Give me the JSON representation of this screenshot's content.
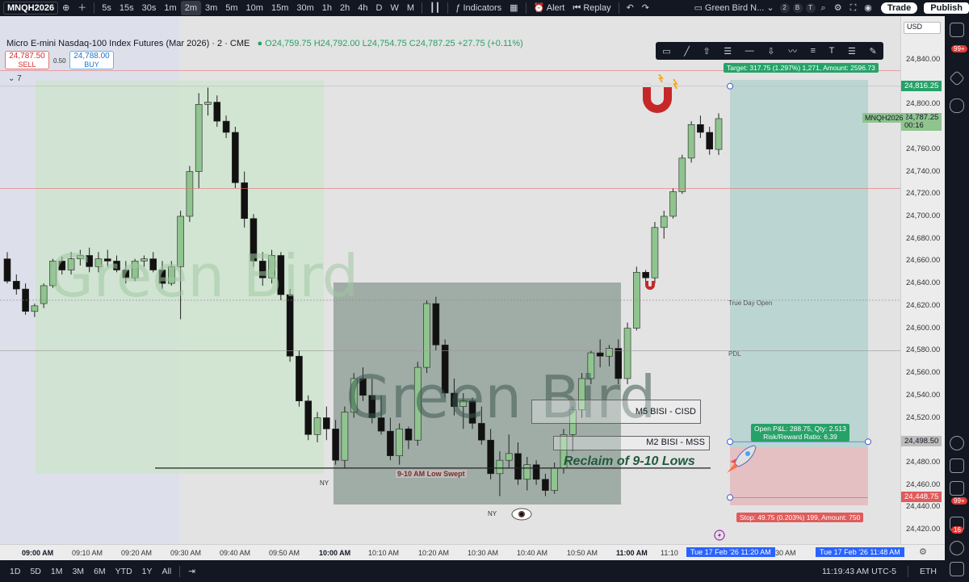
{
  "topbar": {
    "symbol": "MNQH2026",
    "intervals": [
      "5s",
      "15s",
      "30s",
      "1m",
      "2m",
      "3m",
      "5m",
      "10m",
      "15m",
      "30m",
      "1h",
      "2h",
      "4h",
      "D",
      "W",
      "M"
    ],
    "active_interval": "2m",
    "indicators_label": "Indicators",
    "alert_label": "Alert",
    "replay_label": "Replay",
    "layout_name": "Green Bird N...",
    "layout_badges": [
      "2",
      "B",
      "T"
    ],
    "trade_label": "Trade",
    "publish_label": "Publish"
  },
  "header": {
    "title": "Micro E-mini Nasdaq-100 Index Futures (Mar 2026) · 2 · CME",
    "ohlc": "O24,759.75  H24,792.00  L24,754.75  C24,787.25  +27.75 (+0.11%)",
    "sell_price": "24,787.50",
    "sell_label": "SELL",
    "spread": "0.50",
    "buy_price": "24,788.00",
    "buy_label": "BUY",
    "collapse_count": "7"
  },
  "currency": "USD",
  "drawing_tools": [
    "rectangle",
    "line",
    "arrow-up",
    "multi",
    "hline",
    "arrow-down",
    "path",
    "fib",
    "text",
    "lines",
    "brush"
  ],
  "price_axis": {
    "labels": [
      "24,840.00",
      "24,800.00",
      "24,760.00",
      "24,740.00",
      "24,720.00",
      "24,700.00",
      "24,680.00",
      "24,660.00",
      "24,640.00",
      "24,620.00",
      "24,600.00",
      "24,580.00",
      "24,560.00",
      "24,540.00",
      "24,520.00",
      "24,480.00",
      "24,460.00",
      "24,440.00",
      "24,420.00"
    ],
    "target_tag": "24,816.25",
    "current_symbol": "MNQH2026",
    "current_price": "24,787.25",
    "countdown": "00:16",
    "entry_tag": "24,498.50",
    "stop_tag": "24,448.75"
  },
  "time_axis": {
    "labels": [
      "09:00 AM",
      "09:10 AM",
      "09:20 AM",
      "09:30 AM",
      "09:40 AM",
      "09:50 AM",
      "10:00 AM",
      "10:10 AM",
      "10:20 AM",
      "10:30 AM",
      "10:40 AM",
      "10:50 AM",
      "11:00 AM",
      "11:10"
    ],
    "bold_labels": [
      "09:00 AM",
      "10:00 AM",
      "11:00 AM"
    ],
    "range_start": "Tue 17 Feb '26   11:20 AM",
    "mid_label": "30 AM",
    "range_end": "Tue 17 Feb '26   11:48 AM"
  },
  "annotations": {
    "target_label": "Target: 317.75 (1.297%) 1,271, Amount: 2596.73",
    "stop_label": "Stop: 49.75 (0.203%) 199, Amount: 750",
    "pnl_line1": "Open P&L: 288.75, Qty: 2.513",
    "pnl_line2": "Risk/Reward Ratio: 6.39",
    "true_day_open": "True Day Open",
    "pdl": "PDL",
    "m5_box": "M5 BISI - CISD",
    "m2_box": "M2 BISI - MSS",
    "swept": "9-10 AM Low Swept",
    "reclaim": "Reclaim of 9-10 Lows",
    "ny1": "NY",
    "ny2": "NY",
    "watermark": "Green Bird"
  },
  "bottombar": {
    "ranges": [
      "1D",
      "5D",
      "1M",
      "3M",
      "6M",
      "YTD",
      "1Y",
      "All"
    ],
    "clock": "11:19:43 AM UTC-5",
    "session": "ETH"
  },
  "rail_badges": [
    "99+",
    "99+",
    "16"
  ],
  "chart_data": {
    "type": "candlestick",
    "symbol": "MNQH2026",
    "interval": "2m",
    "ohlc_last": {
      "open": 24759.75,
      "high": 24792.0,
      "low": 24754.75,
      "close": 24787.25,
      "change": 27.75,
      "change_pct": 0.11
    },
    "ylim": [
      24410,
      24850
    ],
    "levels": {
      "target": 24816.25,
      "entry": 24498.5,
      "stop": 24448.75,
      "true_day_open": 24625,
      "pdl": 24580,
      "low_swept": 24475
    },
    "candles": [
      [
        24662,
        24668,
        24640,
        24642
      ],
      [
        24642,
        24648,
        24630,
        24635
      ],
      [
        24635,
        24640,
        24612,
        24615
      ],
      [
        24615,
        24622,
        24610,
        24620
      ],
      [
        24622,
        24640,
        24618,
        24638
      ],
      [
        24638,
        24662,
        24636,
        24660
      ],
      [
        24660,
        24664,
        24648,
        24652
      ],
      [
        24652,
        24668,
        24648,
        24662
      ],
      [
        24662,
        24670,
        24656,
        24665
      ],
      [
        24665,
        24672,
        24650,
        24655
      ],
      [
        24655,
        24668,
        24650,
        24662
      ],
      [
        24662,
        24670,
        24655,
        24660
      ],
      [
        24660,
        24665,
        24650,
        24652
      ],
      [
        24652,
        24660,
        24640,
        24645
      ],
      [
        24645,
        24662,
        24642,
        24660
      ],
      [
        24660,
        24665,
        24655,
        24662
      ],
      [
        24662,
        24668,
        24650,
        24652
      ],
      [
        24652,
        24660,
        24635,
        24640
      ],
      [
        24640,
        24660,
        24638,
        24655
      ],
      [
        24655,
        24705,
        24608,
        24700
      ],
      [
        24700,
        24745,
        24695,
        24740
      ],
      [
        24740,
        24810,
        24725,
        24800
      ],
      [
        24800,
        24815,
        24790,
        24802
      ],
      [
        24802,
        24808,
        24780,
        24785
      ],
      [
        24785,
        24790,
        24770,
        24775
      ],
      [
        24775,
        24780,
        24725,
        24730
      ],
      [
        24730,
        24740,
        24690,
        24698
      ],
      [
        24698,
        24702,
        24655,
        24660
      ],
      [
        24660,
        24668,
        24638,
        24645
      ],
      [
        24645,
        24670,
        24640,
        24665
      ],
      [
        24665,
        24668,
        24625,
        24630
      ],
      [
        24630,
        24635,
        24570,
        24575
      ],
      [
        24575,
        24580,
        24530,
        24535
      ],
      [
        24535,
        24540,
        24500,
        24505
      ],
      [
        24505,
        24525,
        24498,
        24520
      ],
      [
        24520,
        24530,
        24500,
        24510
      ],
      [
        24510,
        24518,
        24478,
        24482
      ],
      [
        24482,
        24530,
        24475,
        24525
      ],
      [
        24525,
        24560,
        24520,
        24555
      ],
      [
        24555,
        24565,
        24535,
        24540
      ],
      [
        24540,
        24555,
        24515,
        24520
      ],
      [
        24520,
        24540,
        24505,
        24508
      ],
      [
        24508,
        24520,
        24482,
        24486
      ],
      [
        24486,
        24515,
        24478,
        24510
      ],
      [
        24510,
        24512,
        24492,
        24500
      ],
      [
        24500,
        24570,
        24495,
        24565
      ],
      [
        24565,
        24625,
        24560,
        24622
      ],
      [
        24622,
        24628,
        24580,
        24585
      ],
      [
        24585,
        24590,
        24538,
        24542
      ],
      [
        24542,
        24555,
        24522,
        24530
      ],
      [
        24530,
        24542,
        24510,
        24535
      ],
      [
        24535,
        24538,
        24510,
        24515
      ],
      [
        24515,
        24530,
        24496,
        24500
      ],
      [
        24500,
        24510,
        24465,
        24470
      ],
      [
        24470,
        24490,
        24450,
        24482
      ],
      [
        24482,
        24505,
        24475,
        24488
      ],
      [
        24488,
        24498,
        24460,
        24465
      ],
      [
        24465,
        24485,
        24455,
        24478
      ],
      [
        24478,
        24482,
        24460,
        24465
      ],
      [
        24465,
        24470,
        24450,
        24455
      ],
      [
        24455,
        24480,
        24452,
        24475
      ],
      [
        24475,
        24510,
        24470,
        24505
      ],
      [
        24505,
        24530,
        24490,
        24527
      ],
      [
        24527,
        24560,
        24520,
        24555
      ],
      [
        24555,
        24580,
        24550,
        24578
      ],
      [
        24578,
        24590,
        24565,
        24575
      ],
      [
        24575,
        24585,
        24566,
        24582
      ],
      [
        24582,
        24590,
        24550,
        24555
      ],
      [
        24555,
        24605,
        24550,
        24600
      ],
      [
        24600,
        24655,
        24598,
        24650
      ],
      [
        24650,
        24652,
        24640,
        24645
      ],
      [
        24645,
        24695,
        24640,
        24690
      ],
      [
        24690,
        24705,
        24680,
        24700
      ],
      [
        24700,
        24725,
        24698,
        24722
      ],
      [
        24722,
        24755,
        24720,
        24752
      ],
      [
        24752,
        24785,
        24748,
        24782
      ],
      [
        24782,
        24790,
        24770,
        24775
      ],
      [
        24775,
        24780,
        24755,
        24760
      ],
      [
        24759.75,
        24792,
        24754.75,
        24787.25
      ]
    ]
  }
}
